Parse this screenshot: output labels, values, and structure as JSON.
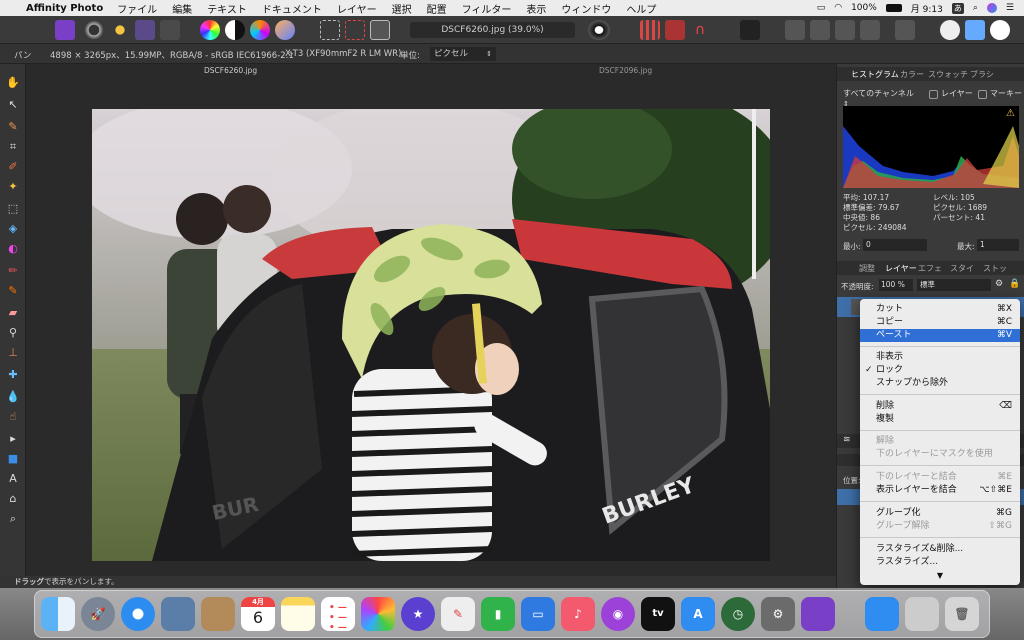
{
  "menubar": {
    "app_name": "Affinity Photo",
    "menus": [
      "ファイル",
      "編集",
      "テキスト",
      "ドキュメント",
      "レイヤー",
      "選択",
      "配置",
      "フィルター",
      "表示",
      "ウィンドウ",
      "ヘルプ"
    ],
    "battery": "100%",
    "clock": "月 9:13",
    "input_method": "あ"
  },
  "toolbar": {
    "document_title": "DSCF6260.jpg (39.0%)"
  },
  "contextbar": {
    "tool_name": "パン",
    "image_info": "4898 × 3265px、15.99MP、RGBA/8 - sRGB IEC61966-2.1",
    "camera": "X-T3 (XF90mmF2 R LM WR)",
    "units_label": "単位:",
    "units_value": "ピクセル"
  },
  "tabs": [
    "DSCF6260.jpg",
    "DSCF2096.jpg"
  ],
  "status": {
    "bold": "ドラッグ",
    "text": "で表示をパンします。"
  },
  "histogram_panel": {
    "tabs": [
      "ヒストグラム",
      "カラー",
      "スウォッチ",
      "ブラシ"
    ],
    "channel": "すべてのチャンネル",
    "layer_label": "レイヤー",
    "marquee_label": "マーキー",
    "stats_left": [
      {
        "label": "平均:",
        "value": "107.17"
      },
      {
        "label": "標準偏差:",
        "value": "79.67"
      },
      {
        "label": "中央値:",
        "value": "86"
      },
      {
        "label": "ピクセル:",
        "value": "249084"
      }
    ],
    "stats_right": [
      {
        "label": "レベル:",
        "value": "105"
      },
      {
        "label": "ピクセル:",
        "value": "1689"
      },
      {
        "label": "パーセント:",
        "value": "41"
      }
    ],
    "min_label": "最小:",
    "min_value": "0",
    "max_label": "最大:",
    "max_value": "1"
  },
  "layers_panel": {
    "tabs": [
      "調整",
      "レイヤー",
      "エフェ",
      "スタイ",
      "ストッ"
    ],
    "opacity_label": "不透明度:",
    "opacity_value": "100 %",
    "blend_mode": "標準",
    "position_label": "位置:"
  },
  "context_menu": {
    "group1": [
      {
        "label": "カット",
        "shortcut": "⌘X",
        "state": "normal"
      },
      {
        "label": "コピー",
        "shortcut": "⌘C",
        "state": "normal"
      },
      {
        "label": "ペースト",
        "shortcut": "⌘V",
        "state": "selected"
      }
    ],
    "group2": [
      {
        "label": "非表示",
        "shortcut": "",
        "state": "normal",
        "check": ""
      },
      {
        "label": "ロック",
        "shortcut": "",
        "state": "normal",
        "check": "✓"
      },
      {
        "label": "スナップから除外",
        "shortcut": "",
        "state": "normal",
        "check": ""
      }
    ],
    "group3": [
      {
        "label": "削除",
        "shortcut": "⌫",
        "state": "normal"
      },
      {
        "label": "複製",
        "shortcut": "",
        "state": "normal"
      }
    ],
    "group4": [
      {
        "label": "解除",
        "shortcut": "",
        "state": "disabled"
      },
      {
        "label": "下のレイヤーにマスクを使用",
        "shortcut": "",
        "state": "disabled"
      }
    ],
    "group5": [
      {
        "label": "下のレイヤーと結合",
        "shortcut": "⌘E",
        "state": "disabled"
      },
      {
        "label": "表示レイヤーを結合",
        "shortcut": "⌥⇧⌘E",
        "state": "normal"
      }
    ],
    "group6": [
      {
        "label": "グループ化",
        "shortcut": "⌘G",
        "state": "normal"
      },
      {
        "label": "グループ解除",
        "shortcut": "⇧⌘G",
        "state": "disabled"
      }
    ],
    "group7": [
      {
        "label": "ラスタライズ&削除...",
        "shortcut": "",
        "state": "normal"
      },
      {
        "label": "ラスタライズ...",
        "shortcut": "",
        "state": "normal"
      }
    ],
    "more_arrow": "▼"
  },
  "dock": {
    "calendar_month": "4月",
    "calendar_day": "6"
  },
  "photo": {
    "helmet_brand": "BURLEY",
    "trailer_text": "BUR"
  }
}
